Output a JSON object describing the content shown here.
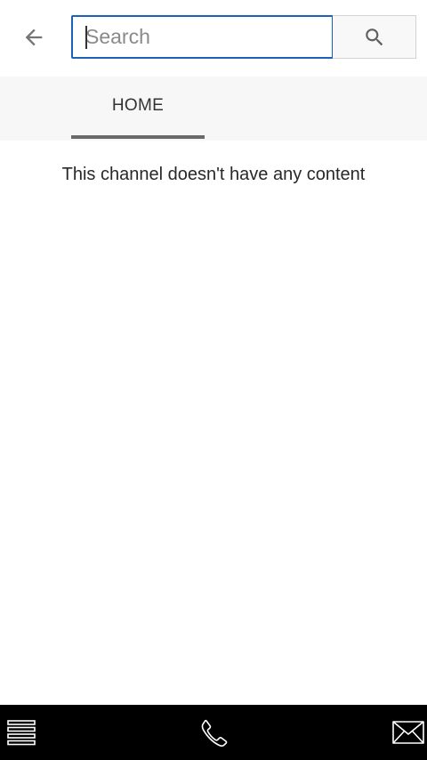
{
  "search": {
    "placeholder": "Search",
    "value": ""
  },
  "tabs": [
    {
      "label": "HOME",
      "active": true
    }
  ],
  "main": {
    "empty_message": "This channel doesn't have any content"
  },
  "icons": {
    "back": "arrow-left-icon",
    "search": "search-icon",
    "menu": "hamburger-menu-icon",
    "phone": "phone-icon",
    "mail": "mail-icon"
  },
  "colors": {
    "search_border": "#1c62b9",
    "tab_indicator": "#6a6a6a",
    "bottom_bar": "#000000"
  }
}
